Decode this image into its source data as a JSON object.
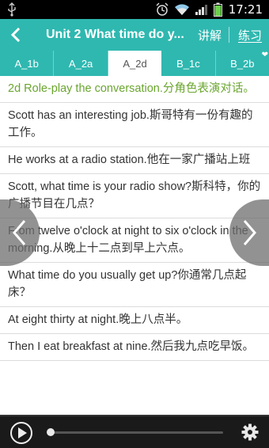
{
  "status_bar": {
    "time": "17:21",
    "icons": [
      "usb-icon",
      "alarm-icon",
      "wifi-icon",
      "signal-icon",
      "battery-icon"
    ]
  },
  "header": {
    "back_icon": "chevron-left-icon",
    "title": "Unit 2 What time do y...",
    "explain_label": "讲解",
    "practice_label": "练习",
    "bg_color": "#2fb8b0"
  },
  "tabs": [
    {
      "label": "A_1b",
      "active": false,
      "favorite": false
    },
    {
      "label": "A_2a",
      "active": false,
      "favorite": false
    },
    {
      "label": "A_2d",
      "active": true,
      "favorite": true
    },
    {
      "label": "B_1c",
      "active": false,
      "favorite": false
    },
    {
      "label": "B_2b",
      "active": false,
      "favorite": true
    }
  ],
  "content": {
    "heading": "2d Role-play the conversation.分角色表演对话。",
    "heading_color": "#6aa52e",
    "lines": [
      "Scott has an interesting job.斯哥特有一份有趣的工作。",
      "He works at a radio station.他在一家广播站上班",
      "Scott, what time is your radio show?斯科特，你的广播节目在几点？",
      "From twelve o'clock at night to six o'clock in the morning.从晚上十二点到早上六点。",
      "What time do you usually get up?你通常几点起床？",
      "At eight thirty at night.晚上八点半。",
      "Then I eat breakfast at nine.然后我九点吃早饭。"
    ]
  },
  "navigation": {
    "prev_icon": "chevron-left-icon",
    "next_icon": "chevron-right-icon"
  },
  "player": {
    "play_icon": "play-icon",
    "settings_icon": "gear-icon",
    "progress": 0.0
  }
}
